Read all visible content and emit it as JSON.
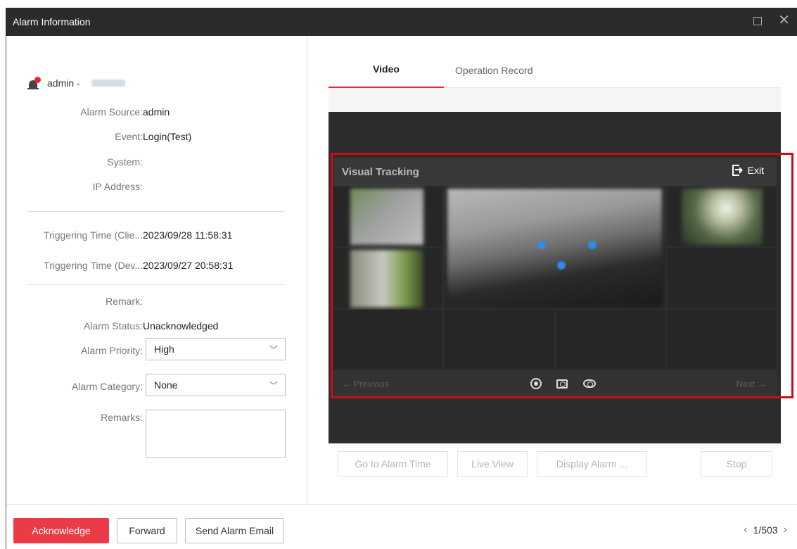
{
  "window": {
    "title": "Alarm Information"
  },
  "user": {
    "name": "admin -"
  },
  "details": {
    "alarm_source": {
      "label": "Alarm Source:",
      "value": "admin"
    },
    "event": {
      "label": "Event:",
      "value": "Login(Test)"
    },
    "system": {
      "label": "System:",
      "value": ""
    },
    "ip_address": {
      "label": "IP Address:",
      "value": ""
    },
    "trigger_client": {
      "label": "Triggering Time (Clie...",
      "value": "2023/09/28 11:58:31"
    },
    "trigger_device": {
      "label": "Triggering Time (Dev...",
      "value": "2023/09/27 20:58:31"
    },
    "remark": {
      "label": "Remark:",
      "value": ""
    },
    "alarm_status": {
      "label": "Alarm Status:",
      "value": "Unacknowledged"
    },
    "alarm_priority": {
      "label": "Alarm Priority:",
      "value": "High"
    },
    "alarm_category": {
      "label": "Alarm Category:",
      "value": "None"
    },
    "remarks": {
      "label": "Remarks:",
      "value": ""
    }
  },
  "tabs": [
    {
      "label": "Video",
      "active": true
    },
    {
      "label": "Operation Record",
      "active": false
    }
  ],
  "visual_tracking": {
    "title": "Visual Tracking",
    "exit_label": "Exit",
    "prev_label": "← Previous",
    "next_label": "Next →"
  },
  "playback_buttons": {
    "go_to_alarm_time": "Go to Alarm Time",
    "live_view": "Live View",
    "display_alarm": "Display Alarm ...",
    "stop": "Stop"
  },
  "footer": {
    "acknowledge": "Acknowledge",
    "forward": "Forward",
    "send_email": "Send Alarm Email",
    "pager": "1/503"
  },
  "colors": {
    "accent": "#ea3b47",
    "highlight_frame": "#c4101b",
    "titlebar": "#2b2b2b"
  }
}
